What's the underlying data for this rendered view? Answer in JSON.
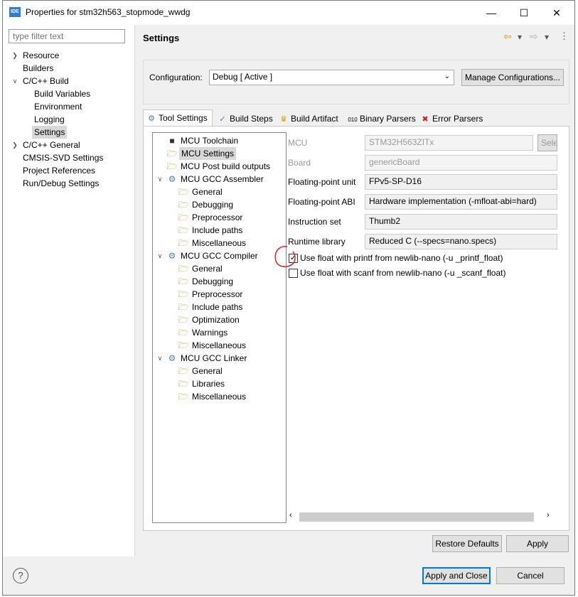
{
  "window": {
    "title": "Properties for stm32h563_stopmode_wwdg",
    "icon_text": "IDE"
  },
  "filter": {
    "placeholder": "type filter text"
  },
  "nav_tree": [
    {
      "label": "Resource",
      "twisty": ">"
    },
    {
      "label": "Builders",
      "twisty": ""
    },
    {
      "label": "C/C++ Build",
      "twisty": "v"
    },
    {
      "label": "Build Variables",
      "twisty": ""
    },
    {
      "label": "Environment",
      "twisty": ""
    },
    {
      "label": "Logging",
      "twisty": ""
    },
    {
      "label": "Settings",
      "twisty": "",
      "selected": true
    },
    {
      "label": "C/C++ General",
      "twisty": ">"
    },
    {
      "label": "CMSIS-SVD Settings",
      "twisty": ""
    },
    {
      "label": "Project References",
      "twisty": ""
    },
    {
      "label": "Run/Debug Settings",
      "twisty": ""
    }
  ],
  "header": {
    "title": "Settings"
  },
  "configuration": {
    "label": "Configuration:",
    "value": "Debug  [ Active ]",
    "manage_button": "Manage Configurations..."
  },
  "tabs": [
    {
      "label": "Tool Settings",
      "icon": "tool-settings-icon",
      "active": true
    },
    {
      "label": "Build Steps",
      "icon": "build-steps-icon"
    },
    {
      "label": "Build Artifact",
      "icon": "build-artifact-icon"
    },
    {
      "label": "Binary Parsers",
      "icon": "binary-parsers-icon"
    },
    {
      "label": "Error Parsers",
      "icon": "error-parsers-icon"
    }
  ],
  "tool_tree": {
    "mcu_toolchain": "MCU Toolchain",
    "mcu_settings": "MCU Settings",
    "mcu_post_build": "MCU Post build outputs",
    "assembler": {
      "label": "MCU GCC Assembler",
      "children": [
        "General",
        "Debugging",
        "Preprocessor",
        "Include paths",
        "Miscellaneous"
      ]
    },
    "compiler": {
      "label": "MCU GCC Compiler",
      "children": [
        "General",
        "Debugging",
        "Preprocessor",
        "Include paths",
        "Optimization",
        "Warnings",
        "Miscellaneous"
      ]
    },
    "linker": {
      "label": "MCU GCC Linker",
      "children": [
        "General",
        "Libraries",
        "Miscellaneous"
      ]
    }
  },
  "properties": {
    "mcu": {
      "label": "MCU",
      "value": "STM32H563ZITx",
      "select_btn": "Select"
    },
    "board": {
      "label": "Board",
      "value": "genericBoard"
    },
    "fpu": {
      "label": "Floating-point unit",
      "value": "FPv5-SP-D16"
    },
    "fabi": {
      "label": "Floating-point ABI",
      "value": "Hardware implementation (-mfloat-abi=hard)"
    },
    "iset": {
      "label": "Instruction set",
      "value": "Thumb2"
    },
    "runtime": {
      "label": "Runtime library",
      "value": "Reduced C (--specs=nano.specs)"
    },
    "printf_float": {
      "label": "Use float with printf from newlib-nano (-u _printf_float)",
      "checked": true
    },
    "scanf_float": {
      "label": "Use float with scanf from newlib-nano (-u _scanf_float)",
      "checked": false
    }
  },
  "buttons": {
    "restore": "Restore Defaults",
    "apply": "Apply",
    "apply_close": "Apply and Close",
    "cancel": "Cancel"
  },
  "colors": {
    "annotation_circle": "#e02020",
    "primary_border": "#0078d7"
  }
}
